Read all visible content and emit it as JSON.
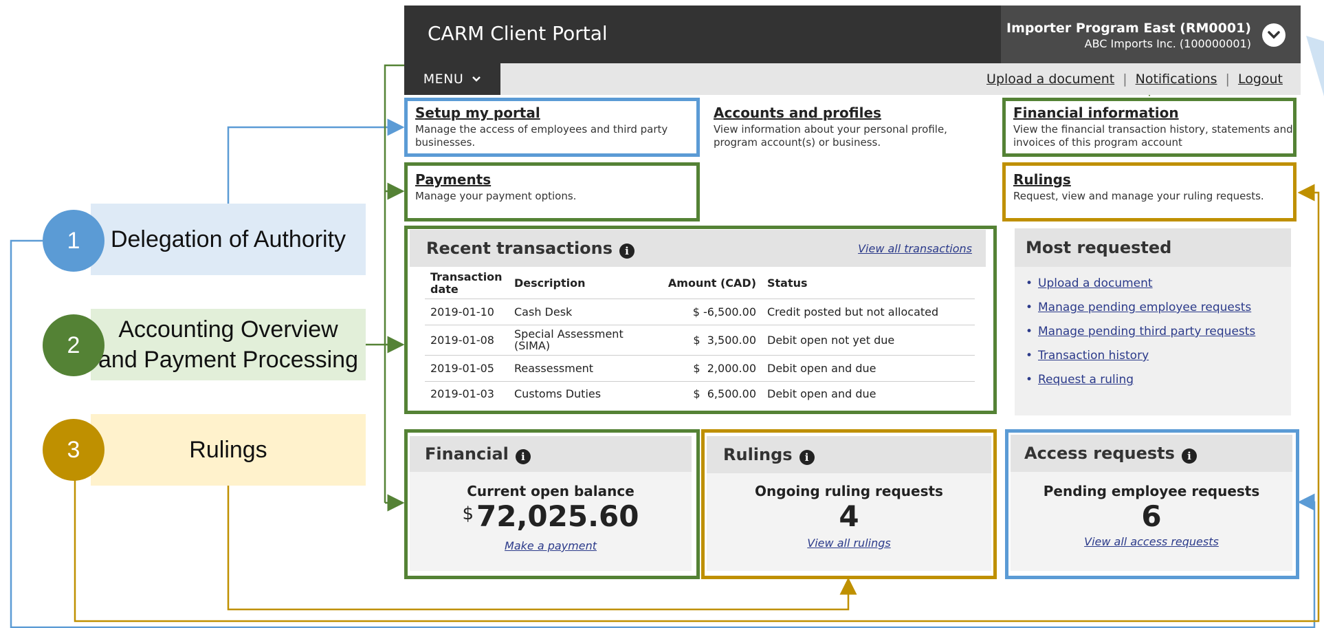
{
  "legend": [
    {
      "number": "1",
      "label": "Delegation of Authority",
      "circle_color": "#5b9bd5",
      "box_color": "#deeaf6"
    },
    {
      "number": "2",
      "label_line1": "Accounting Overview",
      "label_line2": "and Payment Processing",
      "circle_color": "#548235",
      "box_color": "#e2efd9"
    },
    {
      "number": "3",
      "label": "Rulings",
      "circle_color": "#bf9000",
      "box_color": "#fff2cc"
    }
  ],
  "colors": {
    "blue": "#5b9bd5",
    "green": "#548235",
    "gold": "#bf9000"
  },
  "header": {
    "title": "CARM Client Portal",
    "account_name": "Importer Program East (RM0001)",
    "account_sub": "ABC Imports Inc. (100000001)",
    "toggle_icon": "chevron-down-icon"
  },
  "menubar": {
    "menu_label": "MENU",
    "links": [
      "Upload a document",
      "Notifications",
      "Logout"
    ],
    "separator": "|"
  },
  "tiles": [
    {
      "title": "Setup my portal",
      "desc": "Manage the access of employees and third party businesses."
    },
    {
      "title": "Accounts and profiles",
      "desc": "View information about your personal profile, program account(s) or business."
    },
    {
      "title": "Financial information",
      "desc": "View the financial transaction history, statements and invoices of this program account"
    },
    {
      "title": "Payments",
      "desc": "Manage your payment options."
    },
    {
      "title": "Rulings",
      "desc": "Request, view and manage your ruling requests."
    }
  ],
  "transactions": {
    "title": "Recent transactions",
    "view_all": "View all transactions",
    "columns": [
      "Transaction date",
      "Description",
      "Amount (CAD)",
      "Status"
    ],
    "rows": [
      {
        "date": "2019-01-10",
        "description": "Cash Desk",
        "amount": "$ -6,500.00",
        "status": "Credit posted but not allocated"
      },
      {
        "date": "2019-01-08",
        "description": "Special Assessment (SIMA)",
        "amount": "$  3,500.00",
        "status": "Debit open not yet due"
      },
      {
        "date": "2019-01-05",
        "description": "Reassessment",
        "amount": "$  2,000.00",
        "status": "Debit open and due"
      },
      {
        "date": "2019-01-03",
        "description": "Customs Duties",
        "amount": "$  6,500.00",
        "status": "Debit open and due"
      }
    ]
  },
  "most_requested": {
    "title": "Most requested",
    "items": [
      "Upload a document",
      "Manage pending employee requests",
      "Manage pending third party requests",
      "Transaction history",
      "Request a ruling"
    ]
  },
  "financial": {
    "title": "Financial",
    "label": "Current open balance",
    "currency": "$",
    "value": "72,025.60",
    "link": "Make a payment"
  },
  "rulings_panel": {
    "title": "Rulings",
    "label": "Ongoing ruling requests",
    "value": "4",
    "link": "View all rulings"
  },
  "access": {
    "title": "Access requests",
    "label": "Pending employee requests",
    "value": "6",
    "link": "View all access requests"
  },
  "info_icon_glyph": "i"
}
